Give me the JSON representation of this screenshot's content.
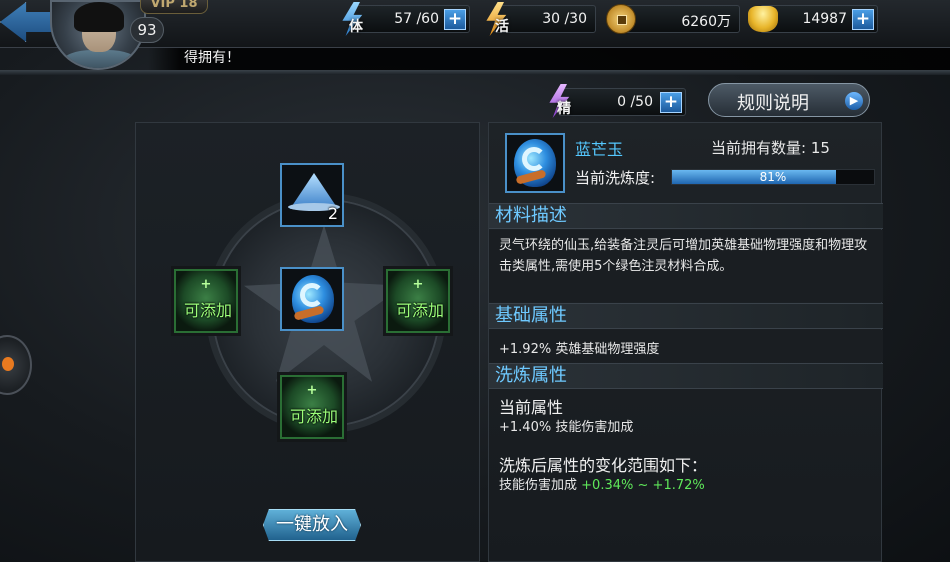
{
  "topbar": {
    "vip": "VIP 18",
    "level": "93",
    "stamina": {
      "label": "体",
      "value": "57 /60"
    },
    "vigor": {
      "label": "活",
      "value": "30 /30"
    },
    "copper": {
      "value": "6260万"
    },
    "gold": {
      "value": "14987"
    },
    "notice": "得拥有！"
  },
  "essence": {
    "label": "精",
    "value": "0 /50"
  },
  "rules_button": "规则说明",
  "left": {
    "top_slot_count": "2",
    "add_slot_plus": "+",
    "add_slot_label": "可添加",
    "auto_button": "一键放入"
  },
  "item": {
    "name": "蓝芒玉",
    "own_label": "当前拥有数量: 15",
    "refine_label": "当前洗炼度:",
    "refine_percent": 81,
    "refine_text": "81%"
  },
  "sections": {
    "desc_title": "材料描述",
    "desc_text": "灵气环绕的仙玉,给装备注灵后可增加英雄基础物理强度和物理攻击类属性,需使用5个绿色注灵材料合成。",
    "basic_title": "基础属性",
    "basic_attr": "+1.92% 英雄基础物理强度",
    "refine_title": "洗炼属性",
    "current_title": "当前属性",
    "current_value": "+1.40% 技能伤害加成",
    "range_title": "洗炼后属性的变化范围如下：",
    "range_name": "技能伤害加成",
    "range_min": "+0.34%",
    "range_sep": "~",
    "range_max": "+1.72%"
  },
  "colors": {
    "accent_blue": "#55c8ff",
    "green_text": "#5fe85a",
    "progress_fill": "#1f66b0"
  },
  "icons": [
    "back-arrow-icon",
    "hero-avatar",
    "lightning-stamina-icon",
    "lightning-vigor-icon",
    "copper-coin-icon",
    "gold-ingot-icon",
    "lightning-essence-icon",
    "blue-jade-gem-icon",
    "blue-mountain-item-icon"
  ]
}
